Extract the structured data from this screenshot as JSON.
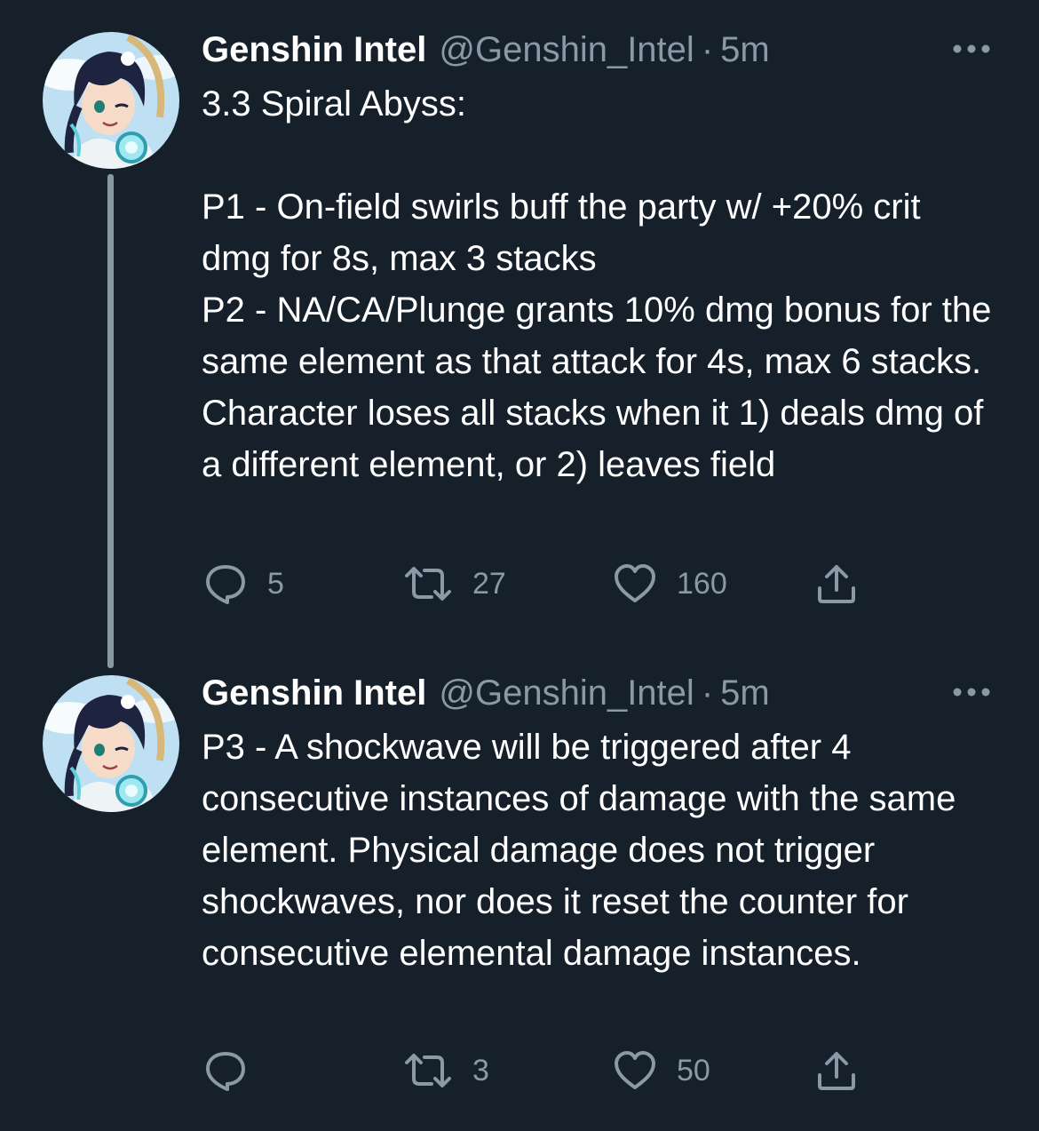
{
  "tweets": [
    {
      "author_name": "Genshin Intel",
      "handle": "@Genshin_Intel",
      "separator": "·",
      "time": "5m",
      "text": "3.3 Spiral Abyss:\n\nP1 - On-field swirls buff the party w/ +20% crit dmg for 8s, max 3 stacks\nP2 - NA/CA/Plunge grants 10% dmg bonus for the same element as that attack for 4s, max 6 stacks. Character loses all stacks when it 1) deals dmg of a different element, or 2) leaves field",
      "reply_count": "5",
      "retweet_count": "27",
      "like_count": "160"
    },
    {
      "author_name": "Genshin Intel",
      "handle": "@Genshin_Intel",
      "separator": "·",
      "time": "5m",
      "text": "P3 - A shockwave will be triggered after 4 consecutive instances of damage with the same element. Physical damage does not trigger shockwaves, nor does it reset the counter for consecutive elemental damage instances.",
      "reply_count": "",
      "retweet_count": "3",
      "like_count": "50"
    }
  ],
  "icons": {
    "more": "more-horizontal-icon",
    "reply": "reply-bubble-icon",
    "retweet": "retweet-arrows-icon",
    "like": "heart-icon",
    "share": "share-upload-icon"
  },
  "colors": {
    "background": "#15202b",
    "primary_text": "#ffffff",
    "secondary_text": "#8b98a5",
    "thread_line": "#8899a6"
  }
}
